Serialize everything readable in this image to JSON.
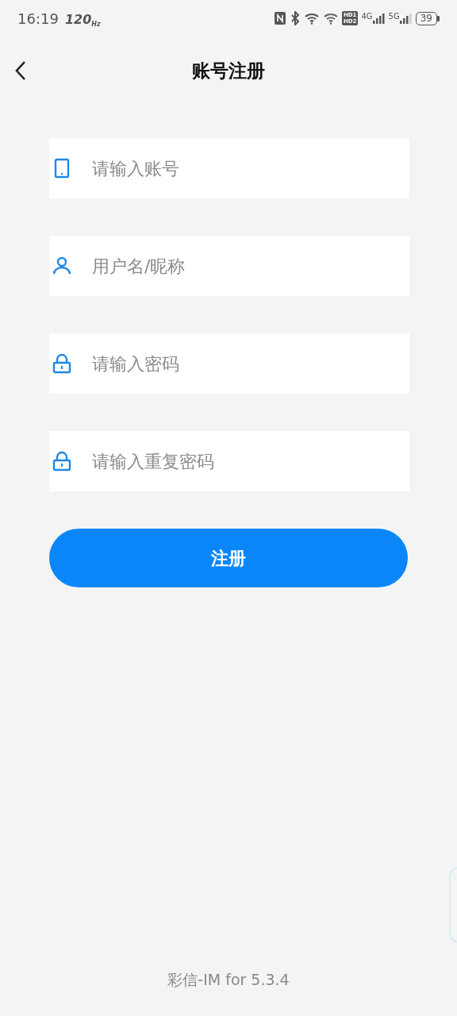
{
  "status_bar": {
    "time": "16:19",
    "refresh_rate": "120",
    "refresh_unit": "Hz",
    "network_labels": [
      "HD1",
      "HD2"
    ],
    "signal_1": "4G",
    "signal_2": "5G",
    "battery": "39"
  },
  "header": {
    "title": "账号注册"
  },
  "fields": [
    {
      "kind": "phone",
      "placeholder": "请输入账号"
    },
    {
      "kind": "user",
      "placeholder": "用户名/昵称"
    },
    {
      "kind": "lock",
      "placeholder": "请输入密码"
    },
    {
      "kind": "lock",
      "placeholder": "请输入重复密码"
    }
  ],
  "submit_button": "注册",
  "footer": "彩信-IM for 5.3.4"
}
